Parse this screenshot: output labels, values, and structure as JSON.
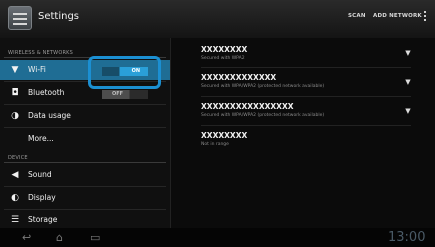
{
  "header": {
    "title": "Settings",
    "scan_label": "SCAN",
    "add_network_label": "ADD NETWORK",
    "menu_icon": "overflow-menu-icon"
  },
  "sidebar": {
    "section_wireless": "WIRELESS & NETWORKS",
    "section_device": "DEVICE",
    "items": [
      {
        "label": "Wi-Fi",
        "icon": "wifi-icon",
        "toggle": "ON"
      },
      {
        "label": "Bluetooth",
        "icon": "bluetooth-icon",
        "toggle": "OFF"
      },
      {
        "label": "Data usage",
        "icon": "data-usage-icon"
      },
      {
        "label": "More..."
      },
      {
        "label": "Sound",
        "icon": "sound-icon"
      },
      {
        "label": "Display",
        "icon": "display-icon"
      },
      {
        "label": "Storage",
        "icon": "storage-icon"
      }
    ]
  },
  "networks": [
    {
      "ssid": "XXXXXXXX",
      "security": "Secured with WPA2"
    },
    {
      "ssid": "XXXXXXXXXXXXX",
      "security": "Secured with WPA/WPA2 (protected network available)"
    },
    {
      "ssid": "XXXXXXXXXXXXXXXX",
      "security": "Secured with WPA/WPA2 (protected network available)"
    },
    {
      "ssid": "XXXXXXXX",
      "security": "Not in range"
    }
  ],
  "navbar": {
    "clock": "13:00"
  },
  "colors": {
    "accent": "#1f6d94",
    "highlight": "#1b8fd2",
    "toggle_on": "#2a9fd8"
  }
}
